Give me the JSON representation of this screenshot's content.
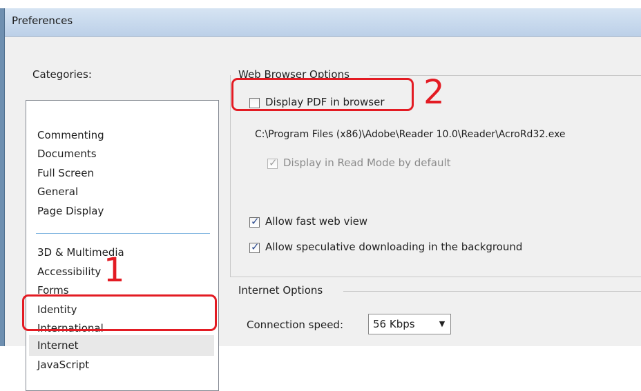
{
  "window": {
    "title": "Preferences"
  },
  "categories": {
    "label": "Categories:",
    "group1": [
      "Commenting",
      "Documents",
      "Full Screen",
      "General",
      "Page Display"
    ],
    "group2": [
      "3D & Multimedia",
      "Accessibility",
      "Forms",
      "Identity",
      "International",
      "Internet",
      "JavaScript"
    ],
    "selected": "Internet"
  },
  "web_browser_options": {
    "heading": "Web Browser Options",
    "display_pdf": {
      "label": "Display PDF in browser",
      "checked": false
    },
    "reader_path": "C:\\Program Files (x86)\\Adobe\\Reader 10.0\\Reader\\AcroRd32.exe",
    "read_mode": {
      "label": "Display in Read Mode by default",
      "checked": true,
      "enabled": false
    },
    "fast_web_view": {
      "label": "Allow fast web view",
      "checked": true
    },
    "speculative_download": {
      "label": "Allow speculative downloading in the background",
      "checked": true
    }
  },
  "internet_options": {
    "heading": "Internet Options",
    "connection_speed_label": "Connection speed:",
    "connection_speed_value": "56 Kbps"
  },
  "annotations": {
    "step1": "1",
    "step2": "2",
    "color": "#e31b23"
  }
}
